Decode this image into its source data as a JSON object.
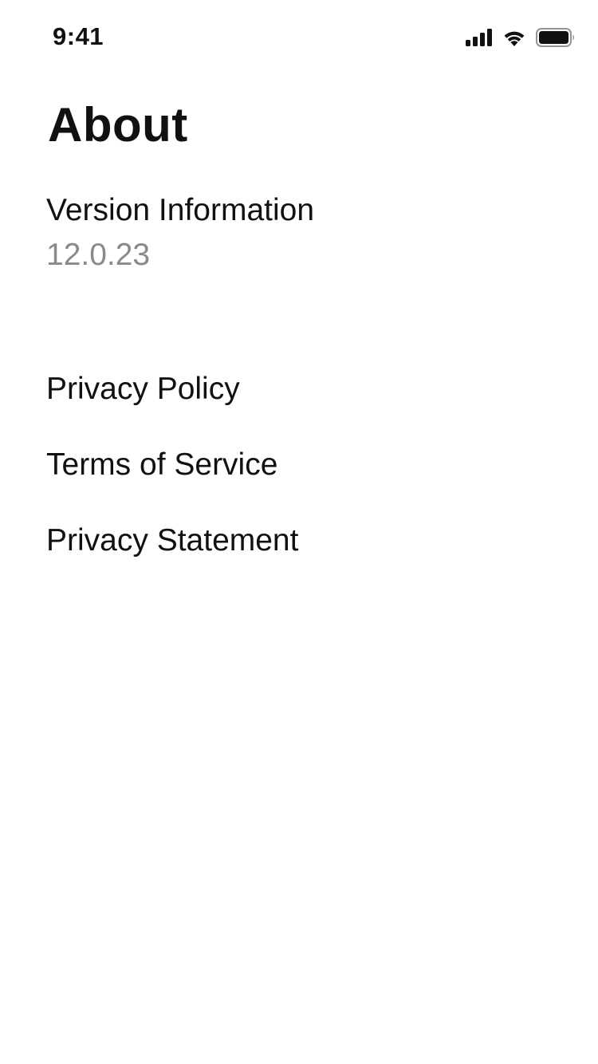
{
  "status_bar": {
    "time": "9:41",
    "icons": [
      "cellular-signal-icon",
      "wifi-icon",
      "battery-icon"
    ],
    "battery_level": 1.0
  },
  "page": {
    "title": "About",
    "version_label": "Version Information",
    "version_value": "12.0.23"
  },
  "menu": {
    "items": [
      {
        "label": "Privacy Policy"
      },
      {
        "label": "Terms of Service"
      },
      {
        "label": "Privacy Statement"
      }
    ]
  },
  "colors": {
    "background": "#ffffff",
    "text_primary": "#111111",
    "text_secondary": "#8a8a8a"
  }
}
